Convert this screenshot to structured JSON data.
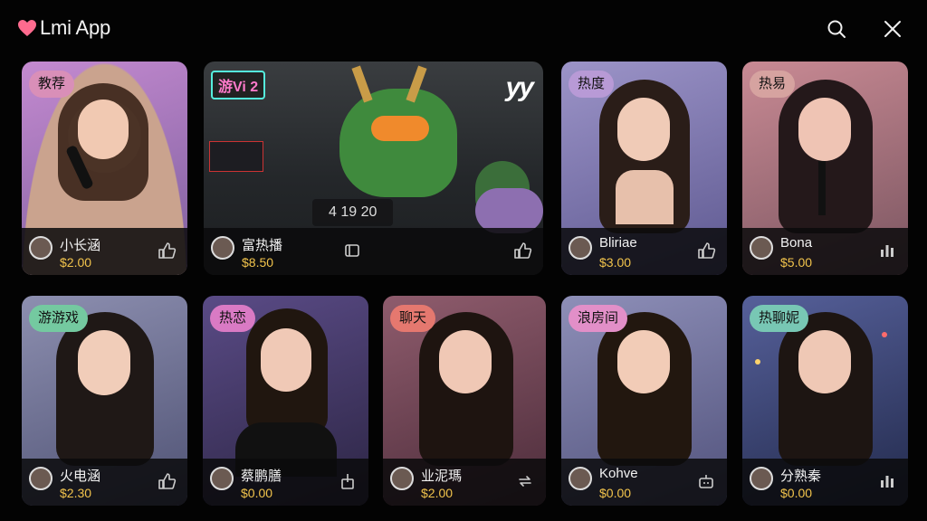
{
  "app": {
    "title": "Lmi App",
    "accent": "#ff5a8a"
  },
  "top_icons": {
    "search": "search-icon",
    "close": "close-icon"
  },
  "cards": [
    {
      "tag": "教荐",
      "tag_color": "#d98fb8",
      "name": "小长涵",
      "price": "$2.00",
      "action_icon": "thumbs-up-icon",
      "bg": "#9b6fb1"
    },
    {
      "tag": "",
      "name": "富热播",
      "price": "$8.50",
      "action_icon": "square-icon",
      "bg": "#2a2c2e",
      "is_game": true,
      "game_badge": "游Vi 2",
      "game_logo": "yy",
      "score": "4 19 20"
    },
    {
      "tag": "热度",
      "tag_color": "#b89ad6",
      "name": "Bliriae",
      "price": "$3.00",
      "action_icon": "thumbs-up-icon",
      "bg": "#7e76b3"
    },
    {
      "tag": "热易",
      "tag_color": "#d6a3a0",
      "name": "Bona",
      "price": "$5.00",
      "action_icon": "chart-icon",
      "bg": "#a9707c"
    },
    {
      "tag": "游游戏",
      "tag_color": "#74c9a0",
      "name": "火电涵",
      "price": "$2.30",
      "action_icon": "thumbs-up-icon",
      "bg": "#6a6b8a"
    },
    {
      "tag": "热恋",
      "tag_color": "#d97ac4",
      "name": "蔡鹏膳",
      "price": "$0.00",
      "action_icon": "bar-icon",
      "bg": "#4e3f6e"
    },
    {
      "tag": "聊天",
      "tag_color": "#e5786f",
      "name": "业泥瑪",
      "price": "$2.00",
      "action_icon": "repeat-icon",
      "bg": "#7a4c63"
    },
    {
      "tag": "浪房间",
      "tag_color": "#e28fc8",
      "name": "Kohve",
      "price": "$0.00",
      "action_icon": "cup-icon",
      "bg": "#5f5f8c"
    },
    {
      "tag": "热聊妮",
      "tag_color": "#78c7b4",
      "name": "分熟秦",
      "price": "$0.00",
      "action_icon": "chart-icon",
      "bg": "#3b4a7a"
    }
  ]
}
